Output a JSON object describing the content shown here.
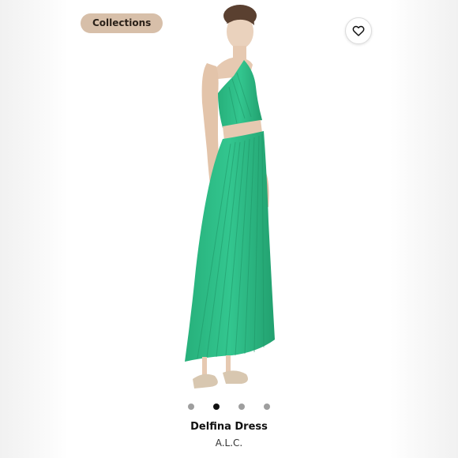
{
  "header": {
    "collections_label": "Collections",
    "favorite_icon": "heart-icon"
  },
  "gallery": {
    "image_count": 4,
    "active_index": 1,
    "dress_color": "#2fbf8a"
  },
  "product": {
    "name": "Delfina Dress",
    "brand": "A.L.C."
  },
  "colors": {
    "pill_bg": "#d7bfa9",
    "dot_active": "#111111",
    "dot_inactive": "#9e9e9e"
  }
}
